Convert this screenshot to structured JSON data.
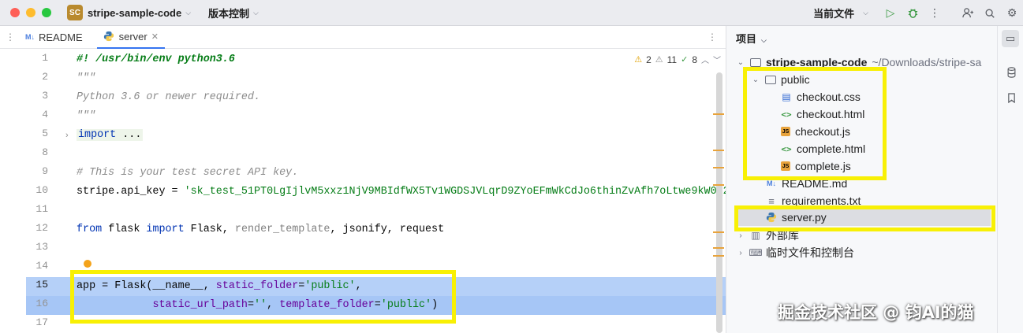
{
  "window": {
    "project_badge": "SC",
    "project_name": "stripe-sample-code",
    "vcs_label": "版本控制",
    "current_file_label": "当前文件"
  },
  "tabs": [
    {
      "label": "README",
      "icon": "markdown-icon"
    },
    {
      "label": "server",
      "icon": "python-icon",
      "active": true
    }
  ],
  "inspections": {
    "warnings": "2",
    "weak_warnings": "11",
    "ok": "8"
  },
  "gutter": {
    "line_numbers": [
      "1",
      "2",
      "3",
      "4",
      "5",
      "8",
      "9",
      "10",
      "11",
      "12",
      "13",
      "14",
      "15",
      "16",
      "17"
    ]
  },
  "code": {
    "l1": "#! /usr/bin/env python3.6",
    "l2": "\"\"\"",
    "l3": "Python 3.6 or newer required.",
    "l4": "\"\"\"",
    "l5_kw": "import",
    "l5_rest": " ...",
    "l9": "# This is your test secret API key.",
    "l10_a": "stripe.api_key = ",
    "l10_str": "'sk_test_51PT0LgIjlvM5xxz1NjV9MBIdfWX5Tv1WGDSJVLqrD9ZYoEFmWkCdJo6thinZvAfh7oLtwe9kW0Q2",
    "l12_from": "from",
    "l12_a": " flask ",
    "l12_import": "import",
    "l12_b": " Flask, ",
    "l12_dim": "render_template",
    "l12_c": ", jsonify, request",
    "l15_a": "app = Flask(__name__, ",
    "l15_param": "static_folder",
    "l15_eq": "=",
    "l15_str": "'public'",
    "l15_end": ",",
    "l16_pad": "            ",
    "l16_param1": "static_url_path",
    "l16_eq1": "=",
    "l16_str1": "''",
    "l16_mid": ", ",
    "l16_param2": "template_folder",
    "l16_eq2": "=",
    "l16_str2": "'public'",
    "l16_end": ")"
  },
  "project": {
    "header": "项目",
    "root": {
      "name": "stripe-sample-code",
      "path": "~/Downloads/stripe-sa"
    },
    "items": [
      {
        "name": "public",
        "type": "folder"
      },
      {
        "name": "checkout.css",
        "type": "css"
      },
      {
        "name": "checkout.html",
        "type": "html"
      },
      {
        "name": "checkout.js",
        "type": "js"
      },
      {
        "name": "complete.html",
        "type": "html"
      },
      {
        "name": "complete.js",
        "type": "js"
      },
      {
        "name": "README.md",
        "type": "md"
      },
      {
        "name": "requirements.txt",
        "type": "txt"
      },
      {
        "name": "server.py",
        "type": "py"
      },
      {
        "name": "外部库",
        "type": "library"
      },
      {
        "name": "临时文件和控制台",
        "type": "scratch"
      }
    ]
  },
  "watermark": "掘金技术社区 @ 钧AI的猫",
  "colors": {
    "highlight_box": "#f8f005",
    "selection": "#a6c6f6",
    "accent": "#3574f0"
  }
}
